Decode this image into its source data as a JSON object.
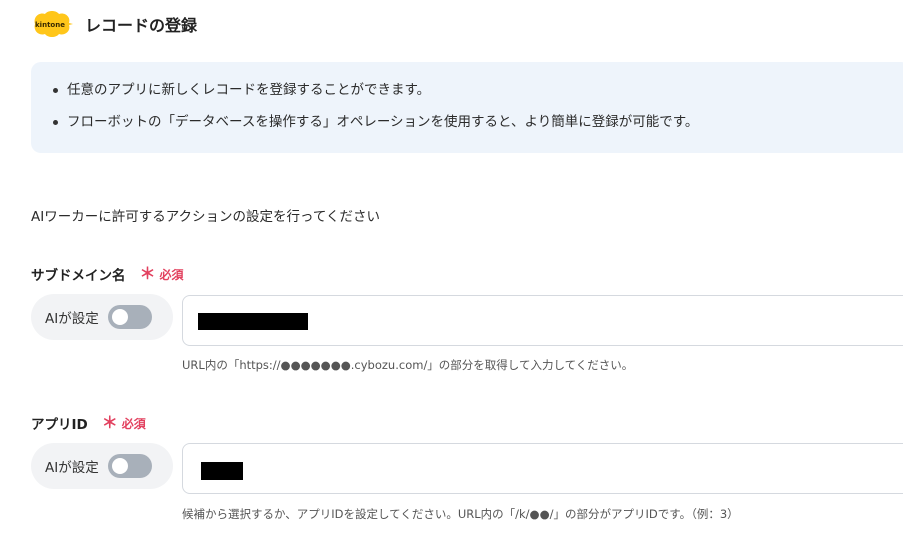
{
  "header": {
    "logo_text": "kintone",
    "title": "レコードの登録"
  },
  "info": {
    "items": [
      "任意のアプリに新しくレコードを登録することができます。",
      "フローボットの「データベースを操作する」オペレーションを使用すると、より簡単に登録が可能です。"
    ]
  },
  "description": "AIワーカーに許可するアクションの設定を行ってください",
  "fields": [
    {
      "label": "サブドメイン名",
      "required_mark": "＊",
      "required_text": "必須",
      "ai_label": "AIが設定",
      "ai_enabled": false,
      "value_redacted": true,
      "hint": "URL内の「https://●●●●●●●.cybozu.com/」の部分を取得して入力してください。"
    },
    {
      "label": "アプリID",
      "required_mark": "＊",
      "required_text": "必須",
      "ai_label": "AIが設定",
      "ai_enabled": false,
      "value_redacted": true,
      "hint": "候補から選択するか、アプリIDを設定してください。URL内の「/k/●●/」の部分がアプリIDです。（例：3）"
    }
  ],
  "colors": {
    "info_bg": "#eef4fb",
    "required": "#e2405e",
    "toggle_off": "#a8b0ba",
    "logo": "#ffc61a"
  }
}
